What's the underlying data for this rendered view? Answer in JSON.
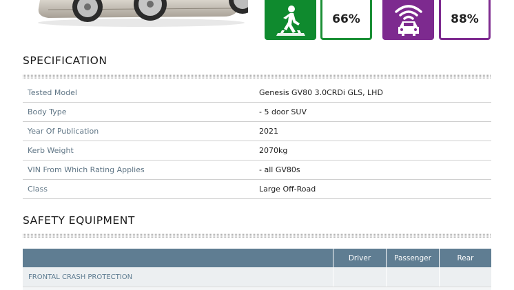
{
  "ratings": {
    "vulnerable_road_users": {
      "icon": "pedestrian-crossing-icon",
      "score": "66%",
      "color": "#0f8a2e"
    },
    "safety_assist": {
      "icon": "car-sensor-icon",
      "score": "88%",
      "color": "#7d2a8f"
    }
  },
  "specification": {
    "title": "SPECIFICATION",
    "rows": [
      {
        "label": "Tested Model",
        "value": "Genesis GV80 3.0CRDi GLS, LHD"
      },
      {
        "label": "Body Type",
        "value": "- 5 door SUV"
      },
      {
        "label": "Year Of Publication",
        "value": "2021"
      },
      {
        "label": "Kerb Weight",
        "value": "2070kg"
      },
      {
        "label": "VIN From Which Rating Applies",
        "value": "- all GV80s"
      },
      {
        "label": "Class",
        "value": "Large Off-Road"
      }
    ]
  },
  "safety_equipment": {
    "title": "SAFETY EQUIPMENT",
    "columns": [
      "Driver",
      "Passenger",
      "Rear"
    ],
    "rows": [
      {
        "label": "FRONTAL CRASH PROTECTION"
      }
    ]
  }
}
